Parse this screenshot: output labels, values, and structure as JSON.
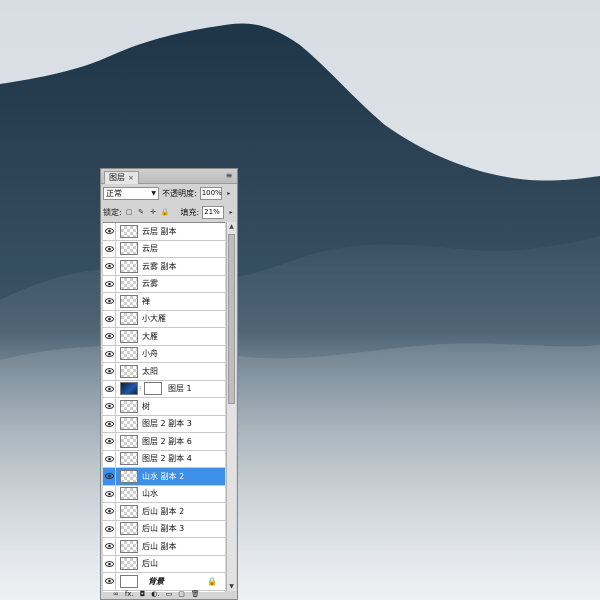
{
  "panel": {
    "tab_label": "图层",
    "tab_close": "×",
    "menu_glyph": "≡",
    "blend_mode": "正常",
    "opacity_label": "不透明度:",
    "opacity_value": "100%",
    "lock_label": "锁定:",
    "fill_label": "填充:",
    "fill_value": "21%",
    "layers": [
      {
        "name": "云层 副本",
        "thumb": "checker",
        "visible": true,
        "selected": false
      },
      {
        "name": "云层",
        "thumb": "checker",
        "visible": true,
        "selected": false
      },
      {
        "name": "云雾 副本",
        "thumb": "checker",
        "visible": true,
        "selected": false
      },
      {
        "name": "云雾",
        "thumb": "checker",
        "visible": true,
        "selected": false
      },
      {
        "name": "禅",
        "thumb": "checker",
        "visible": true,
        "selected": false
      },
      {
        "name": "小大雁",
        "thumb": "checker",
        "visible": true,
        "selected": false
      },
      {
        "name": "大雁",
        "thumb": "checker",
        "visible": true,
        "selected": false
      },
      {
        "name": "小舟",
        "thumb": "checker",
        "visible": true,
        "selected": false
      },
      {
        "name": "太阳",
        "thumb": "checker",
        "visible": true,
        "selected": false
      },
      {
        "name": "图层 1",
        "thumb": "blue-mask",
        "visible": true,
        "selected": false
      },
      {
        "name": "树",
        "thumb": "checker",
        "visible": true,
        "selected": false
      },
      {
        "name": "图层 2 副本 3",
        "thumb": "checker",
        "visible": true,
        "selected": false
      },
      {
        "name": "图层 2 副本 6",
        "thumb": "checker",
        "visible": true,
        "selected": false
      },
      {
        "name": "图层 2 副本 4",
        "thumb": "checker",
        "visible": true,
        "selected": false
      },
      {
        "name": "山水 副本 2",
        "thumb": "checker",
        "visible": true,
        "selected": true
      },
      {
        "name": "山水",
        "thumb": "checker",
        "visible": true,
        "selected": false
      },
      {
        "name": "后山 副本 2",
        "thumb": "checker",
        "visible": true,
        "selected": false
      },
      {
        "name": "后山 副本 3",
        "thumb": "checker",
        "visible": true,
        "selected": false
      },
      {
        "name": "后山 副本",
        "thumb": "checker",
        "visible": true,
        "selected": false
      },
      {
        "name": "后山",
        "thumb": "checker",
        "visible": true,
        "selected": false
      },
      {
        "name": "背景",
        "thumb": "white",
        "visible": true,
        "selected": false,
        "locked": true
      }
    ],
    "footer_icons": [
      "link-icon",
      "fx-icon",
      "mask-icon",
      "adjustment-icon",
      "group-icon",
      "new-layer-icon",
      "trash-icon"
    ],
    "footer_glyphs": [
      "∞",
      "fx.",
      "◘",
      "◐.",
      "▭",
      "▢",
      "🗑"
    ]
  },
  "colors": {
    "mountain_dark": "#1f3748",
    "sky": "#dfe4e8",
    "selection": "#3d8fe8"
  }
}
